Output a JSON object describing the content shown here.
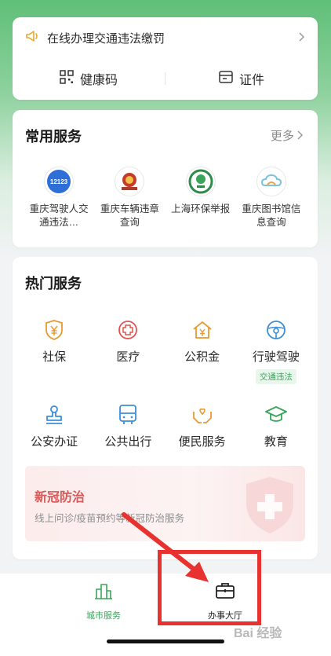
{
  "notice": {
    "text": "在线办理交通违法缴罚"
  },
  "quick_actions": [
    {
      "label": "健康码",
      "icon": "qr-code-icon"
    },
    {
      "label": "证件",
      "icon": "id-card-icon"
    }
  ],
  "common_services": {
    "title": "常用服务",
    "more_label": "更多",
    "items": [
      {
        "name": "重庆驾驶人交通违法…",
        "icon": "traffic-12123-logo"
      },
      {
        "name": "重庆车辆违章查询",
        "icon": "police-badge-logo"
      },
      {
        "name": "上海环保举报",
        "icon": "environment-logo"
      },
      {
        "name": "重庆图书馆信息查询",
        "icon": "library-cloud-logo"
      }
    ]
  },
  "hot_services": {
    "title": "热门服务",
    "items": [
      {
        "label": "社保",
        "icon": "social-security-icon"
      },
      {
        "label": "医疗",
        "icon": "medical-icon"
      },
      {
        "label": "公积金",
        "icon": "housing-fund-icon"
      },
      {
        "label": "行驶驾驶",
        "icon": "steering-wheel-icon",
        "tag": "交通违法"
      },
      {
        "label": "公安办证",
        "icon": "stamp-icon"
      },
      {
        "label": "公共出行",
        "icon": "bus-icon"
      },
      {
        "label": "便民服务",
        "icon": "hands-heart-icon"
      },
      {
        "label": "教育",
        "icon": "graduation-cap-icon"
      }
    ]
  },
  "covid_banner": {
    "title": "新冠防治",
    "subtitle": "线上问诊/疫苗预约等新冠防治服务"
  },
  "bottom_nav": [
    {
      "label": "城市服务",
      "icon": "city-buildings-icon",
      "active": true
    },
    {
      "label": "办事大厅",
      "icon": "briefcase-icon",
      "active": false
    }
  ],
  "colors": {
    "accent": "#3aa55a",
    "annotation": "#e8322f",
    "covid": "#d65a5a"
  },
  "watermark": "Bai 经验"
}
